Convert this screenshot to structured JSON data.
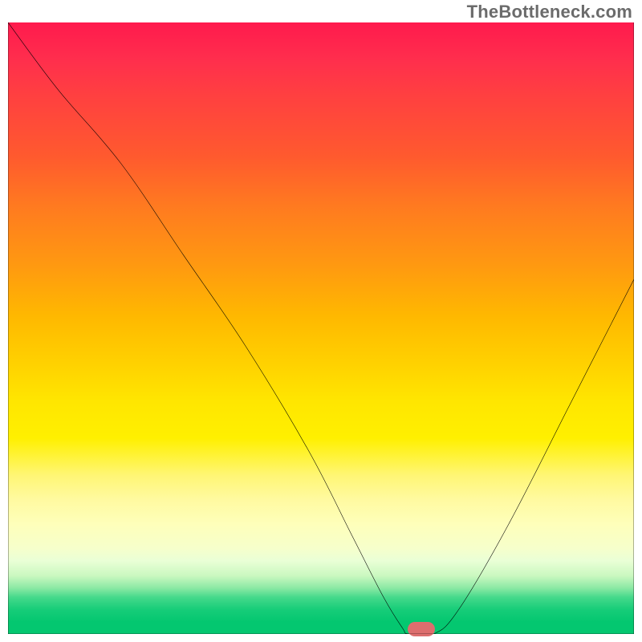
{
  "watermark_text": "TheBottleneck.com",
  "chart_data": {
    "type": "line",
    "title": "",
    "xlabel": "",
    "ylabel": "",
    "xlim": [
      0,
      100
    ],
    "ylim": [
      0,
      100
    ],
    "background_gradient_semantics": "red (high bottleneck) at top → green (low bottleneck) at bottom",
    "series": [
      {
        "name": "bottleneck-curve",
        "x": [
          0,
          8,
          18,
          28,
          38,
          48,
          55,
          60,
          63,
          64,
          68,
          72,
          80,
          90,
          100
        ],
        "y": [
          100,
          89,
          77,
          62,
          47,
          30,
          16,
          6,
          1,
          0,
          0,
          4,
          18,
          38,
          58
        ]
      }
    ],
    "marker": {
      "name": "optimal-point",
      "x": 66,
      "y": 0,
      "color": "#dd6e6e"
    }
  },
  "colors": {
    "curve": "#000000",
    "axis": "#000000",
    "marker": "#dd6e6e"
  }
}
